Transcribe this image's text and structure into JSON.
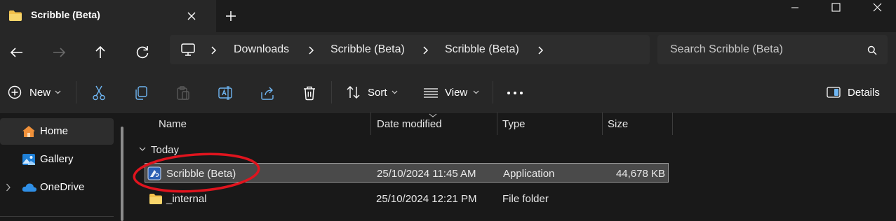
{
  "window": {
    "tab_title": "Scribble (Beta)",
    "icons": [
      "folder-icon",
      "close-tab-icon",
      "new-tab-icon",
      "minimize-icon",
      "maximize-icon",
      "close-window-icon"
    ]
  },
  "address_bar": {
    "breadcrumb": [
      "Downloads",
      "Scribble (Beta)",
      "Scribble (Beta)"
    ],
    "search_placeholder": "Search Scribble (Beta)"
  },
  "toolbar": {
    "new_label": "New",
    "sort_label": "Sort",
    "view_label": "View",
    "details_label": "Details"
  },
  "sidebar": {
    "items": [
      {
        "label": "Home",
        "selected": true
      },
      {
        "label": "Gallery"
      },
      {
        "label": "OneDrive",
        "expandable": true
      }
    ]
  },
  "file_list": {
    "columns": [
      "Name",
      "Date modified",
      "Type",
      "Size"
    ],
    "group_label": "Today",
    "rows": [
      {
        "name": "Scribble (Beta)",
        "date": "25/10/2024 11:45 AM",
        "type": "Application",
        "size": "44,678 KB",
        "icon": "application-icon",
        "selected": true
      },
      {
        "name": "_internal",
        "date": "25/10/2024 12:21 PM",
        "type": "File folder",
        "size": "",
        "icon": "folder-icon"
      }
    ]
  },
  "annotation": {
    "shape": "ellipse",
    "color": "#e0141e"
  },
  "colors": {
    "background": "#191919",
    "chrome": "#272727",
    "folder": "#f3c14b",
    "accent_blue": "#4aa3ee"
  }
}
